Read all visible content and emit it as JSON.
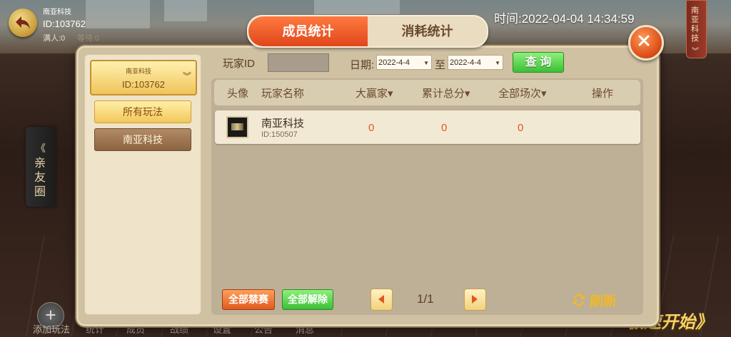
{
  "header": {
    "club_name": "南亚科技",
    "club_id": "ID:103762",
    "full_count": "满人:0",
    "waiting": "等待:0",
    "time": "时间:2022-04-04 14:34:59",
    "right_tab": "南亚科技"
  },
  "side": {
    "friends_tab": "亲友圈"
  },
  "dialog": {
    "tabs": [
      "成员统计",
      "消耗统计"
    ],
    "active_tab": 0,
    "left_panel": {
      "club_name": "南亚科技",
      "club_id": "ID:103762",
      "filters": [
        "所有玩法",
        "南亚科技"
      ]
    },
    "filters": {
      "player_id_label": "玩家ID",
      "player_id_value": "",
      "date_label": "日期:",
      "date_from": "2022-4-4",
      "to_label": "至",
      "date_to": "2022-4-4",
      "query_button": "查 询"
    },
    "table": {
      "headers": [
        "头像",
        "玩家名称",
        "大赢家▾",
        "累计总分▾",
        "全部场次▾",
        "操作"
      ],
      "rows": [
        {
          "name": "南亚科技",
          "id": "ID:150507",
          "big_winner": "0",
          "total_score": "0",
          "total_games": "0"
        }
      ]
    },
    "footer": {
      "ban_all": "全部禁赛",
      "unban_all": "全部解除",
      "page": "1/1",
      "refresh": "刷新"
    }
  },
  "bottom_bar": {
    "items": [
      "添加玩法",
      "统计",
      "成员",
      "战绩",
      "设置",
      "公告",
      "消息"
    ],
    "start": "极速开始》"
  },
  "colors": {
    "accent_orange": "#e0461a",
    "confirm_green": "#3cbf38",
    "panel_beige": "#cfc1a2",
    "value_orange": "#e0571e"
  }
}
